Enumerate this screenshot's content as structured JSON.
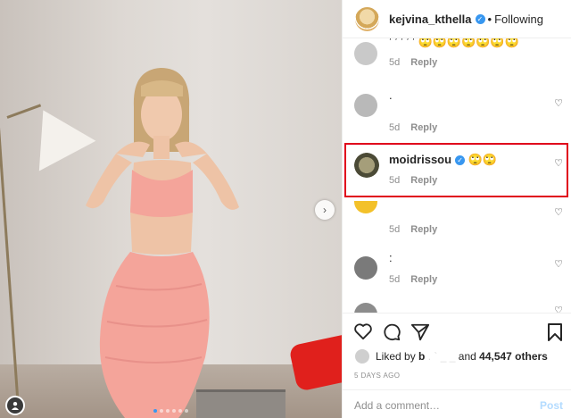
{
  "post": {
    "author": "kejvina_kthella",
    "follow_separator": "•",
    "follow_status": "Following",
    "verified_glyph": "✓"
  },
  "photo": {
    "alt": "Woman in pink two-piece outfit standing by a wall with a lamp",
    "next_arrow": "›",
    "carousel_dots": 6,
    "active_dot": 0
  },
  "comments": [
    {
      "username": "",
      "text": "ʼ ʼ ʼ ʼ ʼ 🙄🙄🙄🙄🙄🙄🙄",
      "time": "5d",
      "reply": "Reply",
      "avatar_color": "#c9c9c9"
    },
    {
      "username": "",
      "text": ".",
      "time": "5d",
      "reply": "Reply",
      "avatar_color": "#b9b9b9"
    },
    {
      "username": "moidrissou",
      "text": "🙄🙄",
      "time": "5d",
      "reply": "Reply",
      "avatar_color": "#6b6b4f",
      "verified": true
    },
    {
      "username": "",
      "text": "",
      "time": "5d",
      "reply": "Reply",
      "avatar_color": "#f3c12a"
    },
    {
      "username": "",
      "text": ":",
      "time": "5d",
      "reply": "Reply",
      "avatar_color": "#7a7a7a"
    },
    {
      "username": "",
      "text": "",
      "time": "",
      "reply": "",
      "avatar_color": "#8c8c8c"
    }
  ],
  "actions": {
    "liked_by_prefix": "Liked by",
    "liked_by_user": "b",
    "liked_by_and": "and",
    "others_count": "44,547 others",
    "timestamp": "5 DAYS AGO",
    "comment_placeholder": "Add a comment…",
    "post_button": "Post"
  },
  "icons": {
    "heart": "heart-icon",
    "comment": "comment-icon",
    "share": "share-icon",
    "save": "bookmark-icon"
  },
  "colors": {
    "highlight": "#e0001b",
    "link_blue": "#3897f0",
    "post_button": "#b3dbff"
  }
}
